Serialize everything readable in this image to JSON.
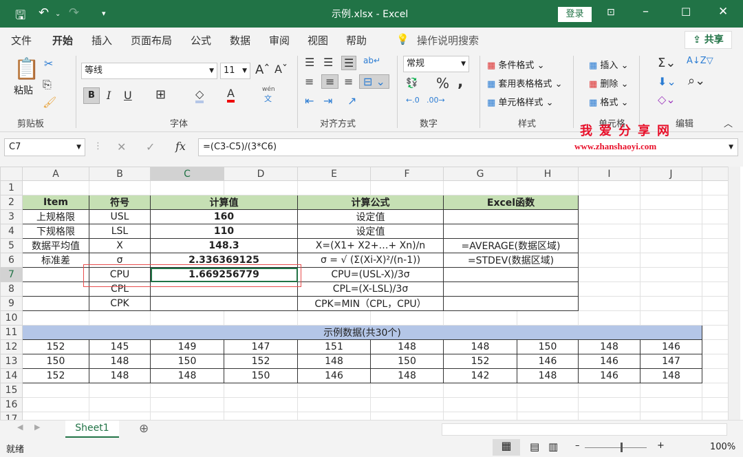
{
  "titlebar": {
    "title": "示例.xlsx  -  Excel",
    "login": "登录",
    "icons": [
      "save-icon",
      "undo-icon",
      "redo-icon",
      "customize-icon",
      "ribbon-display-icon",
      "minimize-icon",
      "maximize-icon",
      "close-icon"
    ]
  },
  "menu": {
    "items": [
      "文件",
      "开始",
      "插入",
      "页面布局",
      "公式",
      "数据",
      "审阅",
      "视图",
      "帮助"
    ],
    "active": "开始",
    "search": "操作说明搜索",
    "share": "共享"
  },
  "ribbon": {
    "clipboard": {
      "paste": "粘贴",
      "group": "剪贴板"
    },
    "font": {
      "name": "等线",
      "size": "11",
      "bold": "B",
      "italic": "I",
      "underline": "U",
      "group": "字体",
      "phonetic": "wén",
      "phonetic2": "文"
    },
    "alignment": {
      "group": "对齐方式"
    },
    "number": {
      "format": "常规",
      "group": "数字"
    },
    "styles": {
      "items": [
        "条件格式",
        "套用表格格式",
        "单元格样式"
      ],
      "group": "样式"
    },
    "cells": {
      "items": [
        "插入",
        "删除",
        "格式"
      ],
      "group": "单元格"
    },
    "editing": {
      "group": "编辑"
    }
  },
  "watermark": {
    "line1": "我爱分享网",
    "line2": "www.zhanshaoyi.com"
  },
  "formula_bar": {
    "name_box": "C7",
    "formula": "=(C3-C5)/(3*C6)",
    "fx": "fx"
  },
  "sheet": {
    "columns": [
      "A",
      "B",
      "C",
      "D",
      "E",
      "F",
      "G",
      "H",
      "I",
      "J"
    ],
    "selected_cell": "C7",
    "table": {
      "header": [
        "Item",
        "符号",
        "计算值",
        "计算公式",
        "Excel函数"
      ],
      "rows": [
        [
          "上规格限",
          "USL",
          "160",
          "设定值",
          ""
        ],
        [
          "下规格限",
          "LSL",
          "110",
          "设定值",
          ""
        ],
        [
          "数据平均值",
          "X",
          "148.3",
          "X=(X1+ X2+…+ Xn)/n",
          "=AVERAGE(数据区域)"
        ],
        [
          "标准差",
          "σ",
          "2.336369125",
          "σ = √ (Σ(Xi-X)²/(n-1))",
          "=STDEV(数据区域)"
        ],
        [
          "",
          "CPU",
          "1.669256779",
          "CPU=(USL-X)/3σ",
          ""
        ],
        [
          "",
          "CPL",
          "",
          "CPL=(X-LSL)/3σ",
          ""
        ],
        [
          "",
          "CPK",
          "",
          "CPK=MIN（CPL，CPU）",
          ""
        ]
      ]
    },
    "sample_title": "示例数据(共30个)",
    "sample_rows": [
      [
        "152",
        "145",
        "149",
        "147",
        "151",
        "148",
        "148",
        "150",
        "148",
        "146"
      ],
      [
        "150",
        "148",
        "150",
        "152",
        "148",
        "150",
        "152",
        "146",
        "146",
        "147"
      ],
      [
        "152",
        "148",
        "148",
        "150",
        "146",
        "148",
        "142",
        "148",
        "146",
        "148"
      ]
    ]
  },
  "tabs": {
    "sheet": "Sheet1"
  },
  "status": {
    "ready": "就绪",
    "zoom": "100%"
  },
  "colors": {
    "excel_green": "#217346",
    "header_fill": "#c6e0b4",
    "sample_fill": "#b4c6e7",
    "watermark": "#e8102a"
  }
}
